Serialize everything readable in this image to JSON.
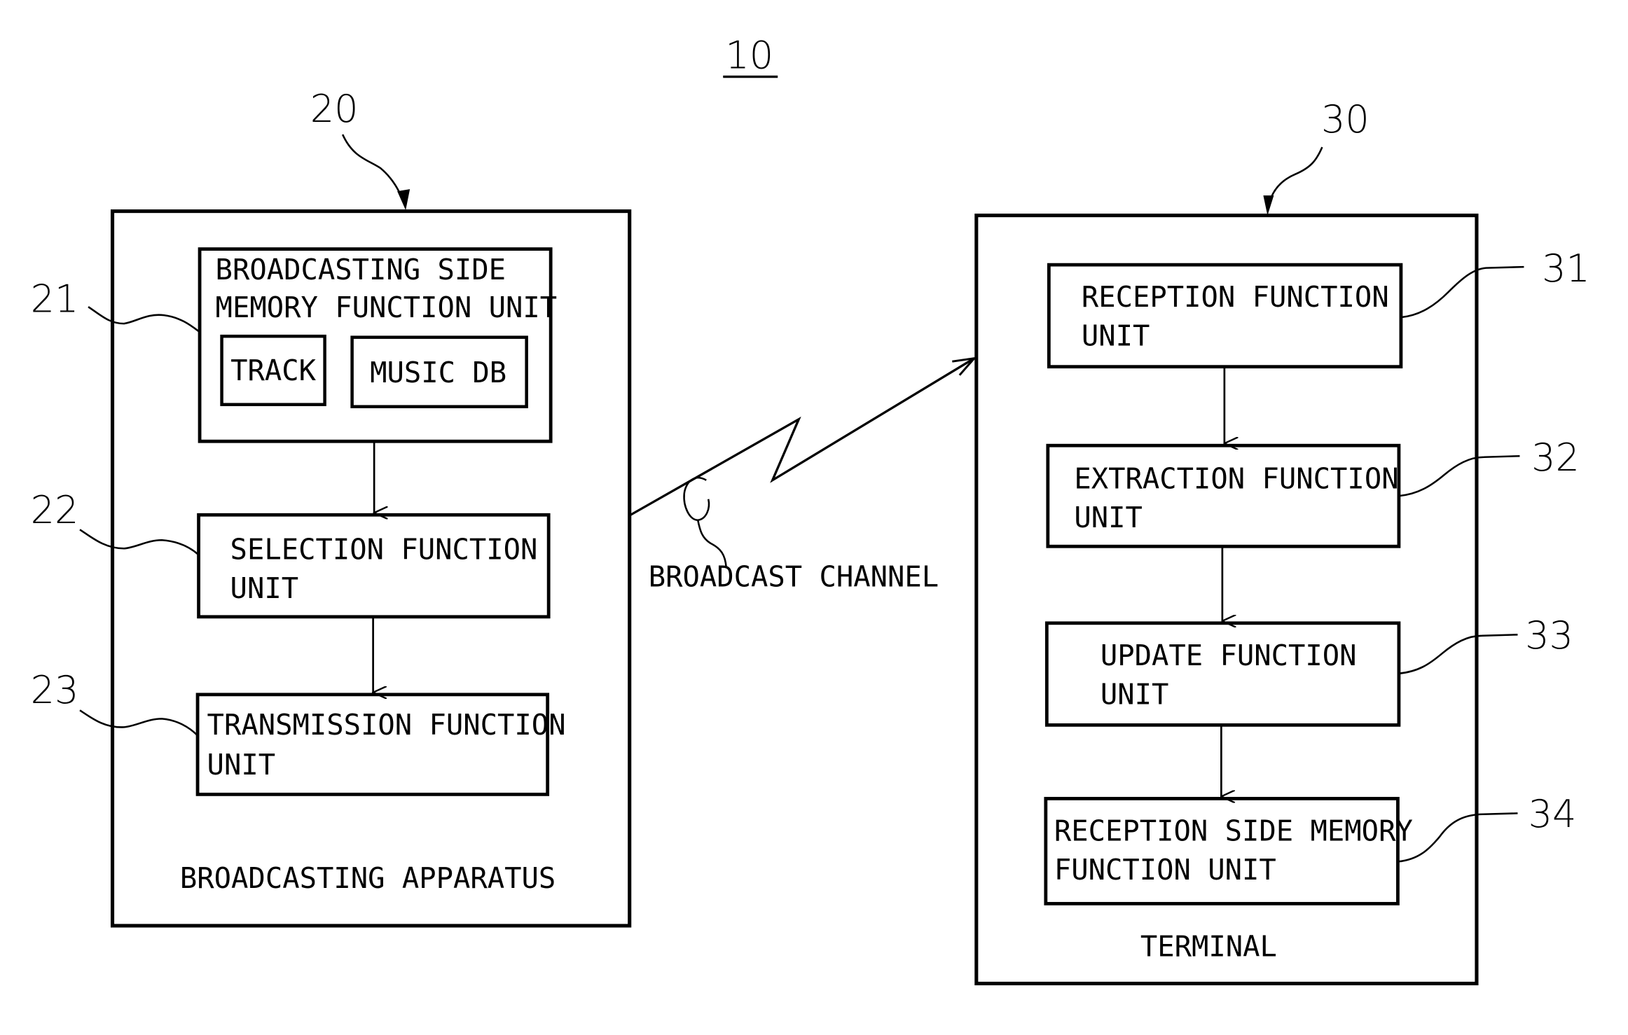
{
  "figure": {
    "number": "10",
    "broadcasting_apparatus": {
      "ref": "20",
      "label": "BROADCASTING APPARATUS",
      "units": [
        {
          "ref": "21",
          "lines": [
            "BROADCASTING SIDE",
            "MEMORY FUNCTION UNIT"
          ],
          "children": [
            "TRACK",
            "MUSIC DB"
          ]
        },
        {
          "ref": "22",
          "lines": [
            "SELECTION FUNCTION",
            "UNIT"
          ]
        },
        {
          "ref": "23",
          "lines": [
            "TRANSMISSION FUNCTION",
            "UNIT"
          ]
        }
      ]
    },
    "channel": {
      "label": "BROADCAST CHANNEL"
    },
    "terminal": {
      "ref": "30",
      "label": "TERMINAL",
      "units": [
        {
          "ref": "31",
          "lines": [
            "RECEPTION FUNCTION",
            "UNIT"
          ]
        },
        {
          "ref": "32",
          "lines": [
            "EXTRACTION FUNCTION",
            "UNIT"
          ]
        },
        {
          "ref": "33",
          "lines": [
            "UPDATE FUNCTION",
            "UNIT"
          ]
        },
        {
          "ref": "34",
          "lines": [
            "RECEPTION SIDE MEMORY",
            "FUNCTION UNIT"
          ]
        }
      ]
    }
  }
}
